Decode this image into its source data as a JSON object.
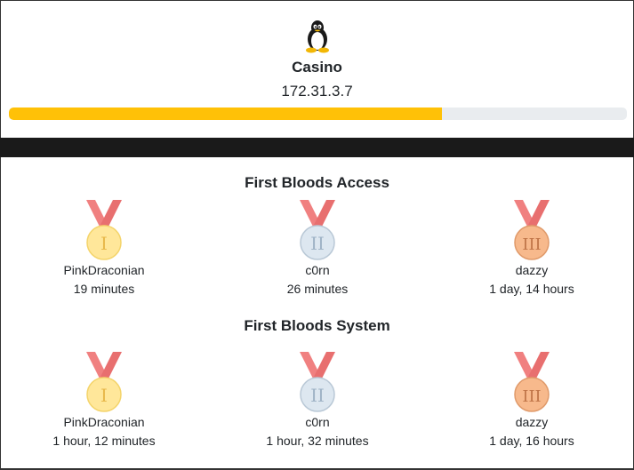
{
  "machine": {
    "os_icon": "linux-penguin-icon",
    "name": "Casino",
    "ip": "172.31.3.7",
    "progress_fraction": 0.7,
    "progress_color": "#ffc107"
  },
  "sections": [
    {
      "title": "First Bloods Access",
      "entries": [
        {
          "rank": "I",
          "medal": "gold-medal-icon",
          "user": "PinkDraconian",
          "time": "19 minutes"
        },
        {
          "rank": "II",
          "medal": "silver-medal-icon",
          "user": "c0rn",
          "time": "26 minutes"
        },
        {
          "rank": "III",
          "medal": "bronze-medal-icon",
          "user": "dazzy",
          "time": "1 day, 14 hours"
        }
      ]
    },
    {
      "title": "First Bloods System",
      "entries": [
        {
          "rank": "I",
          "medal": "gold-medal-icon",
          "user": "PinkDraconian",
          "time": "1 hour, 12 minutes"
        },
        {
          "rank": "II",
          "medal": "silver-medal-icon",
          "user": "c0rn",
          "time": "1 hour, 32 minutes"
        },
        {
          "rank": "III",
          "medal": "bronze-medal-icon",
          "user": "dazzy",
          "time": "1 day, 16 hours"
        }
      ]
    }
  ],
  "colors": {
    "ribbon": "#f08080",
    "gold": "#ffe79a",
    "silver": "#dde7f0",
    "bronze": "#f7b98c"
  }
}
